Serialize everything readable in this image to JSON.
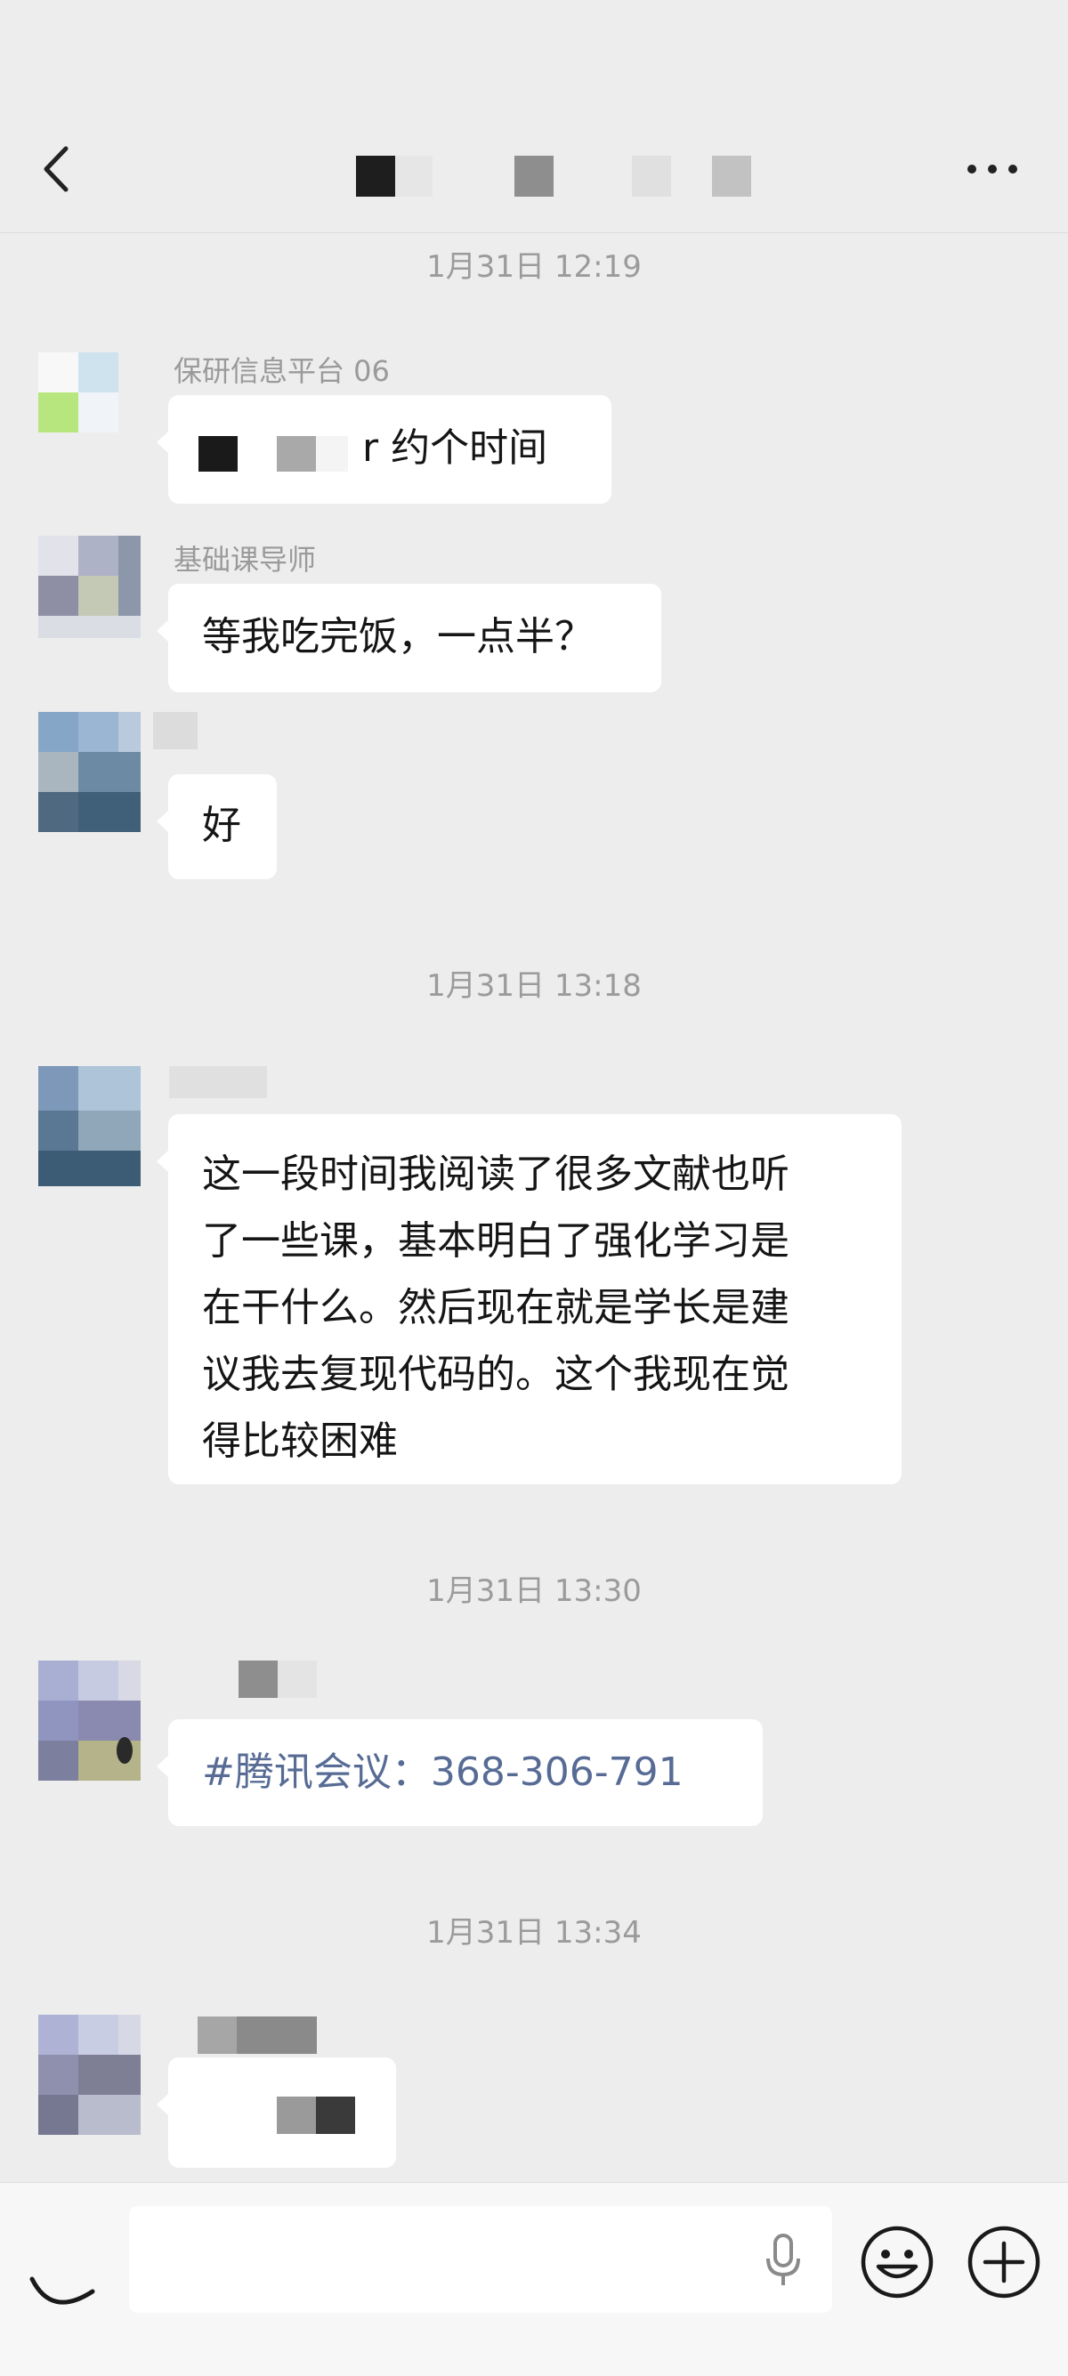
{
  "header": {
    "back_icon": "chevron-left-icon",
    "more_icon": "more-dots-icon"
  },
  "messages": [
    {
      "time": "1月31日 12:19",
      "sender": "保研信息平台 06",
      "text_suffix": "r 约个时间"
    },
    {
      "sender": "基础课导师",
      "text": "等我吃完饭，一点半？"
    },
    {
      "text": "好"
    },
    {
      "time": "1月31日 13:18",
      "text_lines": [
        "这一段时间我阅读了很多文献也听",
        "了一些课，基本明白了强化学习是",
        "在干什么。然后现在就是学长是建",
        "议我去复现代码的。这个我现在觉",
        "得比较困难"
      ]
    },
    {
      "time": "1月31日 13:30",
      "text": "#腾讯会议：368-306-791"
    },
    {
      "time": "1月31日 13:34"
    }
  ],
  "inputbar": {
    "voice_icon": "voice-icon",
    "mic_icon": "microphone-icon",
    "emoji_icon": "emoji-icon",
    "plus_icon": "plus-icon"
  },
  "colors": {
    "background": "#ededed",
    "bubble": "#ffffff",
    "link": "#576b95",
    "timestamp": "#9b9b9b"
  }
}
